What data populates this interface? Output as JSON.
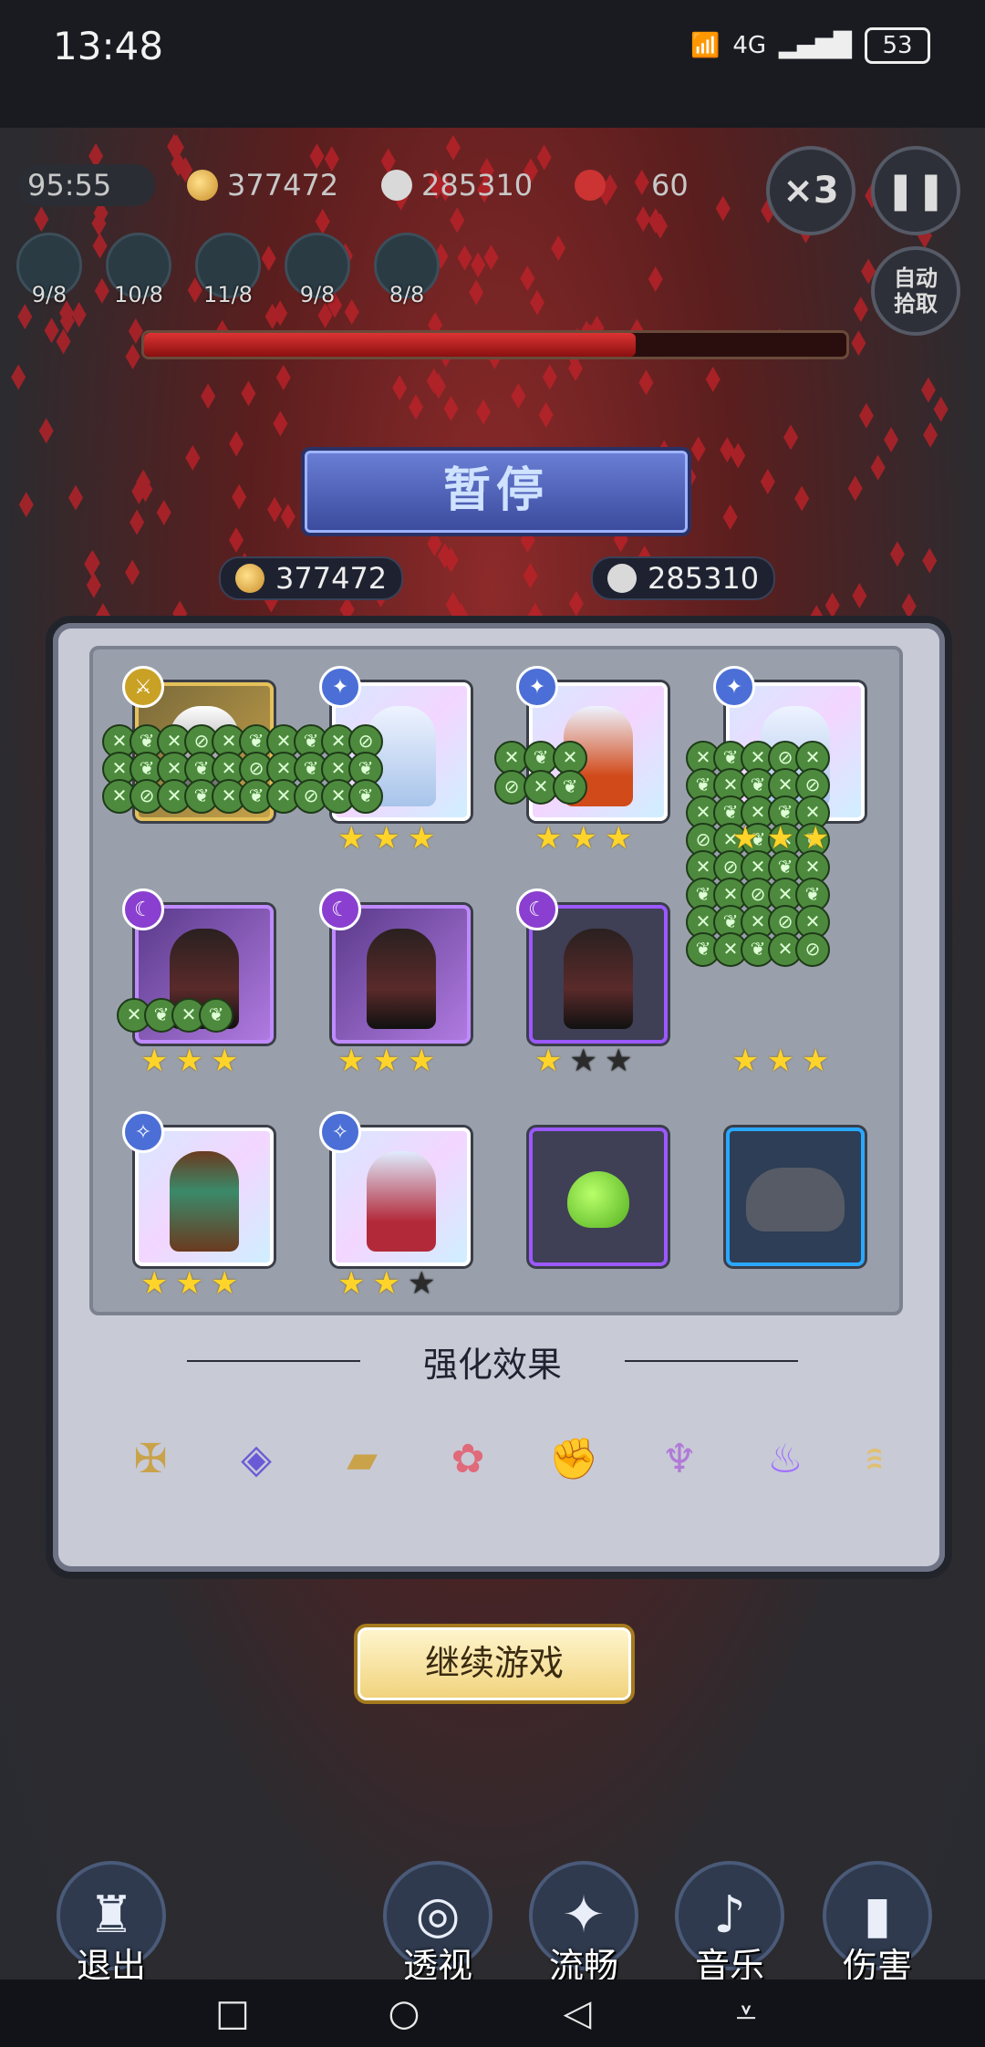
{
  "status_bar": {
    "time": "13:48",
    "network": "4G",
    "battery": "53"
  },
  "hud": {
    "timer": "95:55",
    "coins": "377472",
    "kills": "285310",
    "wave": "60",
    "speed_label": "×3",
    "auto_pickup_label": "自动\n拾取",
    "skill_levels": [
      "9/8",
      "10/8",
      "11/8",
      "9/8",
      "8/8"
    ],
    "boss_hp_fraction": 0.7
  },
  "pause_dialog": {
    "title": "暂停",
    "coins": "377472",
    "kills": "285310",
    "heroes": [
      {
        "stars": 0,
        "max_stars": 0
      },
      {
        "stars": 3,
        "max_stars": 3
      },
      {
        "stars": 3,
        "max_stars": 3
      },
      {
        "stars": 3,
        "max_stars": 3
      },
      {
        "stars": 3,
        "max_stars": 3
      },
      {
        "stars": 3,
        "max_stars": 3
      },
      {
        "stars": 1,
        "max_stars": 3
      },
      {
        "stars": 3,
        "max_stars": 3
      },
      {
        "stars": 3,
        "max_stars": 3
      },
      {
        "stars": 2,
        "max_stars": 3
      }
    ],
    "enhance_title": "强化效果",
    "buff_icons": [
      "crossbow-icon",
      "spellbook-icon",
      "tome-icon",
      "flower-icon",
      "muscle-icon",
      "totem-icon",
      "fire-icon",
      "wing-icon"
    ],
    "continue_label": "继续游戏"
  },
  "bottom_bar": {
    "exit": "退出",
    "xray": "透视",
    "smooth": "流畅",
    "music": "音乐",
    "damage": "伤害"
  }
}
